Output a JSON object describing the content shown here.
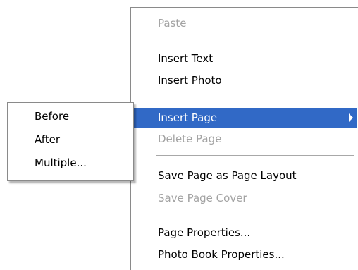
{
  "main_menu": {
    "items": [
      {
        "label": "Paste",
        "state": "disabled"
      },
      {
        "label": "Insert Text",
        "state": "enabled"
      },
      {
        "label": "Insert Photo",
        "state": "enabled"
      },
      {
        "label": "Insert Page",
        "state": "highlighted",
        "has_submenu": true
      },
      {
        "label": "Delete Page",
        "state": "disabled"
      },
      {
        "label": "Save Page as Page Layout",
        "state": "enabled"
      },
      {
        "label": "Save Page Cover",
        "state": "disabled"
      },
      {
        "label": "Page Properties...",
        "state": "enabled"
      },
      {
        "label": "Photo Book Properties...",
        "state": "enabled"
      }
    ]
  },
  "sub_menu": {
    "items": [
      {
        "label": "Before"
      },
      {
        "label": "After"
      },
      {
        "label": "Multiple..."
      }
    ]
  },
  "colors": {
    "highlight_bg": "#3169c6",
    "highlight_text": "#ffffff",
    "disabled_text": "#a3a3a3",
    "text": "#000000"
  },
  "icons": {
    "submenu_arrow": "triangle-right-icon"
  }
}
